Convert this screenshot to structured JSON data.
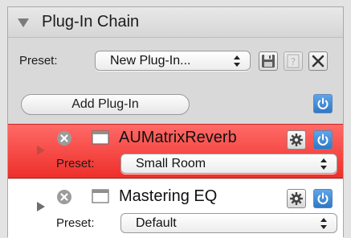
{
  "panel": {
    "title": "Plug-In Chain",
    "preset_label": "Preset:",
    "preset_value": "New Plug-In...",
    "add_button_label": "Add Plug-In",
    "icons": {
      "collapse": "disclosure-triangle-down",
      "save": "floppy-disk-icon",
      "help": "question-mark-icon",
      "close": "x-icon",
      "power": "power-icon"
    }
  },
  "plugins": [
    {
      "name": "AUMatrixReverb",
      "preset_label": "Preset:",
      "preset_value": "Small Room",
      "selected": true,
      "enabled": true
    },
    {
      "name": "Mastering EQ",
      "preset_label": "Preset:",
      "preset_value": "Default",
      "selected": false,
      "enabled": true
    }
  ],
  "colors": {
    "selected_row": "#f0352f",
    "power_button": "#3d87d4",
    "panel_background": "#d9d9d9"
  }
}
